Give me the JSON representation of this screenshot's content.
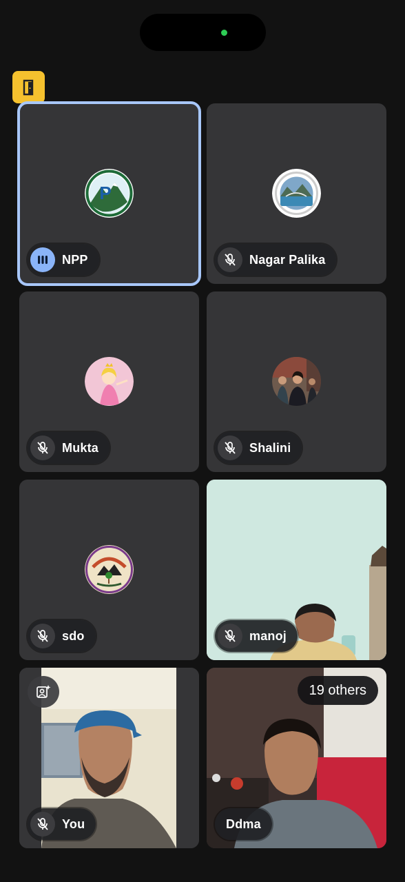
{
  "status_bar": {
    "indicator_color": "#2ecc55"
  },
  "toolbar": {
    "exit_icon": "door-exit-icon",
    "accent": "#f5c12e"
  },
  "participants": [
    {
      "name": "NPP",
      "state": "speaking"
    },
    {
      "name": "Nagar Palika",
      "state": "muted"
    },
    {
      "name": "Mukta",
      "state": "muted"
    },
    {
      "name": "Shalini",
      "state": "muted"
    },
    {
      "name": "sdo",
      "state": "muted"
    },
    {
      "name": "manoj",
      "state": "muted"
    },
    {
      "name": "You",
      "state": "muted"
    },
    {
      "name": "Ddma",
      "state": "unmuted"
    }
  ],
  "others_badge": "19 others",
  "colors": {
    "active_outline": "#a8c7fa",
    "speaking": "#8ab4f8",
    "tile_bg": "#353537"
  }
}
